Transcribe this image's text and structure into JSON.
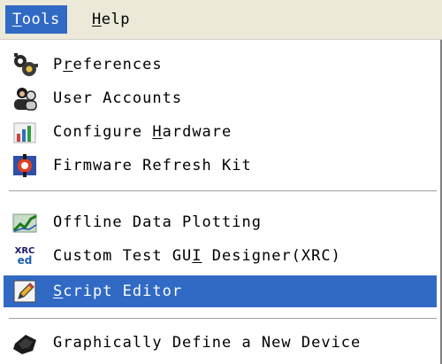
{
  "menubar": {
    "items": [
      {
        "label": "Tools",
        "mnemonic": "T",
        "rest": "ools",
        "active": true
      },
      {
        "label": "Help",
        "mnemonic": "H",
        "rest": "elp",
        "active": false
      }
    ]
  },
  "menu": {
    "items": [
      {
        "pre": "P",
        "mn": "r",
        "post": "eferences",
        "icon": "gears-icon"
      },
      {
        "pre": "User Accounts",
        "mn": "",
        "post": "",
        "icon": "users-icon"
      },
      {
        "pre": "Configure ",
        "mn": "H",
        "post": "ardware",
        "icon": "hardware-chart-icon"
      },
      {
        "pre": "Firmware Refresh Kit",
        "mn": "",
        "post": "",
        "icon": "firmware-chip-icon"
      },
      {
        "pre": "Offline Data Plotting",
        "mn": "",
        "post": "",
        "icon": "data-plot-icon"
      },
      {
        "pre": "Custom Test GU",
        "mn": "I",
        "post": " Designer(XRC)",
        "icon": "xrc-icon"
      },
      {
        "pre": "",
        "mn": "S",
        "post": "cript Editor",
        "icon": "pencil-icon",
        "highlighted": true
      },
      {
        "pre": "Graphically Define a New Device",
        "mn": "",
        "post": "",
        "icon": "device-icon"
      }
    ],
    "xrc_icon_text": {
      "top": "XRC",
      "bottom": "ed"
    }
  },
  "colors": {
    "menubar_bg": "#ece9d8",
    "highlight": "#316ac5",
    "highlight_text": "#ffffff"
  }
}
